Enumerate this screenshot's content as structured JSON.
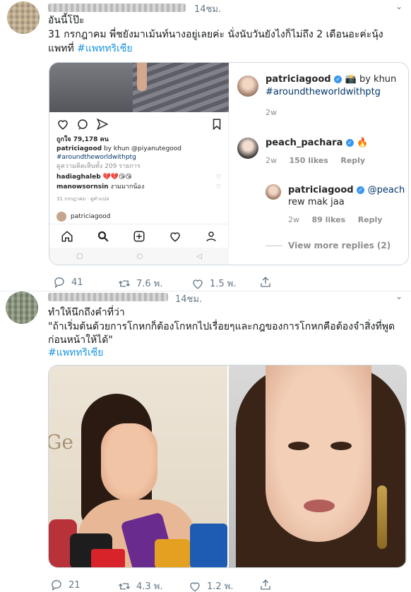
{
  "tweet1": {
    "time": "14ชม.",
    "lines": [
      "อันนี้โป๊ะ",
      "31 กรกฎาคม  พี่ชยังมาเม้นท์นางอยู่เลยค่ะ  นั่งนับวันยังไงก็ไม่ถึง 2 เดือนอะค่ะนุ้ง",
      "แพทที่"
    ],
    "hashtag": "#แพททริเซีย",
    "ig_left": {
      "likes": "ถูกใจ 79,178 คน",
      "caption_user": "patriciagood",
      "caption_text": " by khun @piyanutegood ",
      "caption_tag": "#aroundtheworldwithptg",
      "view_comments": "ดูความคิดเห็นทั้ง 209 รายการ",
      "comment1_user": "hadiaghaleb",
      "comment1_text": " 💔💔😘😘",
      "comment2_user": "manowsornsin",
      "comment2_text": " งามมากน้อง",
      "date": "31 กรกฎาคม",
      "translate": " · ดูคำแปล",
      "next_user": "patriciagood"
    },
    "ig_right": {
      "c1_user": "patriciagood",
      "c1_text": " by khun",
      "c1_tag": "#aroundtheworldwithptg",
      "c1_time": "2w",
      "c2_user": "peach_pachara",
      "c2_emoji": "🔥",
      "c2_time": "2w",
      "c2_likes": "150 likes",
      "c2_reply": "Reply",
      "c3_user": "patriciagood",
      "c3_mention": "@peach",
      "c3_text": "rew mak jaa",
      "c3_time": "2w",
      "c3_likes": "89 likes",
      "c3_reply": "Reply",
      "more_replies": "View more replies (2)"
    },
    "replies": "41",
    "retweets": "7.6 พ.",
    "likes": "1.5 พ."
  },
  "tweet2": {
    "time": "14ชม.",
    "lines": [
      "ทำให้นึกถึงคำที่ว่า",
      "\"ถ้าเริ่มต้นด้วยการโกหกก็ต้องโกหกไปเรื่อยๆและกฎของการโกหกคือต้องจำสิ่งที่พูด",
      "ก่อนหน้าให้ได้\""
    ],
    "hashtag": "#แพททริเซีย",
    "photo_left_text": "Ge     Beau",
    "replies": "21",
    "retweets": "4.3 พ.",
    "likes": "1.2 พ."
  },
  "colors": {
    "link": "#1b95e0",
    "meta": "#657786",
    "border": "#ccd6dd"
  },
  "icons": [
    "reply-icon",
    "retweet-icon",
    "like-icon",
    "share-icon",
    "chevron-down-icon",
    "heart-icon",
    "comment-icon",
    "send-icon",
    "bookmark-icon",
    "home-icon",
    "search-icon",
    "add-icon",
    "profile-icon",
    "verified-icon"
  ]
}
